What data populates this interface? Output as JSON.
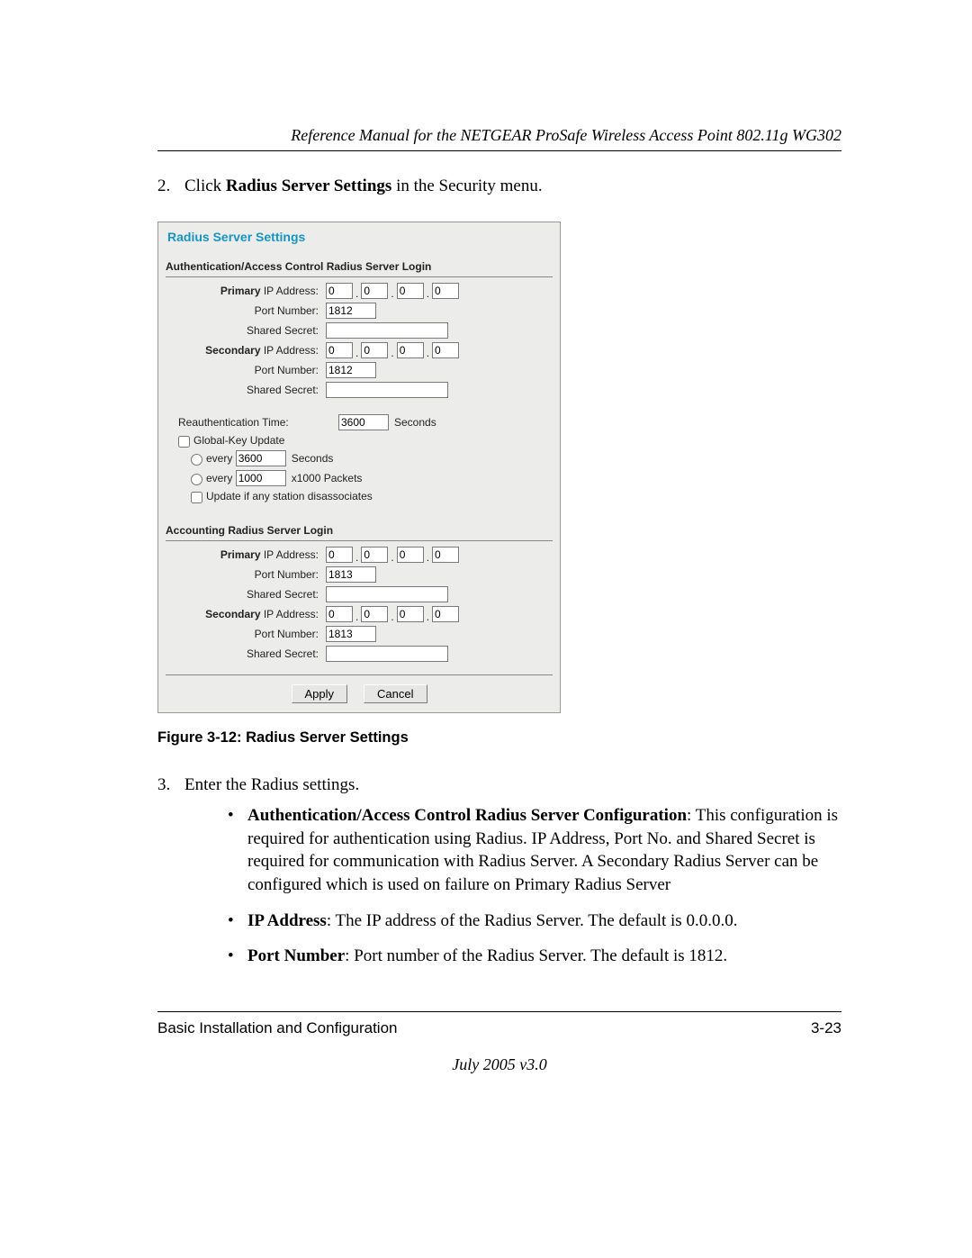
{
  "header": {
    "title": "Reference Manual for the NETGEAR ProSafe Wireless Access Point 802.11g WG302"
  },
  "step2": {
    "num": "2.",
    "prefix": "Click ",
    "bold": "Radius Server Settings",
    "suffix": " in the Security menu."
  },
  "ui": {
    "title": "Radius Server Settings",
    "auth_section": "Authentication/Access Control Radius Server Login",
    "acct_section": "Accounting Radius Server Login",
    "labels": {
      "primary_ip_bold": "Primary",
      "primary_ip_rest": " IP Address:",
      "secondary_ip_bold": "Secondary",
      "secondary_ip_rest": " IP Address:",
      "port": "Port Number:",
      "secret": "Shared Secret:",
      "reauth": "Reauthentication Time:",
      "globalkey": "Global-Key Update",
      "every": "every",
      "seconds": "Seconds",
      "packets": "x1000 Packets",
      "update_disassoc": "Update if any station disassociates"
    },
    "values": {
      "ip_octet": "0",
      "auth_port": "1812",
      "acct_port": "1813",
      "reauth": "3600",
      "every_sec": "3600",
      "every_pkt": "1000"
    },
    "buttons": {
      "apply": "Apply",
      "cancel": "Cancel"
    }
  },
  "figure_caption": "Figure 3-12:  Radius Server Settings",
  "step3": {
    "num": "3.",
    "text": "Enter the Radius settings.",
    "bullets": [
      {
        "bold": "Authentication/Access Control Radius Server Configuration",
        "rest": ": This configuration is required for authentication using Radius. IP Address, Port No. and Shared Secret is required for communication with Radius Server. A Secondary Radius Server can be configured which is used on failure on Primary Radius Server"
      },
      {
        "bold": "IP Address",
        "rest": ": The IP address of the Radius Server. The default is 0.0.0.0."
      },
      {
        "bold": "Port Number",
        "rest": ": Port number of the Radius Server. The default is 1812."
      }
    ]
  },
  "footer": {
    "left": "Basic Installation and Configuration",
    "right": "3-23",
    "date": "July 2005 v3.0"
  }
}
